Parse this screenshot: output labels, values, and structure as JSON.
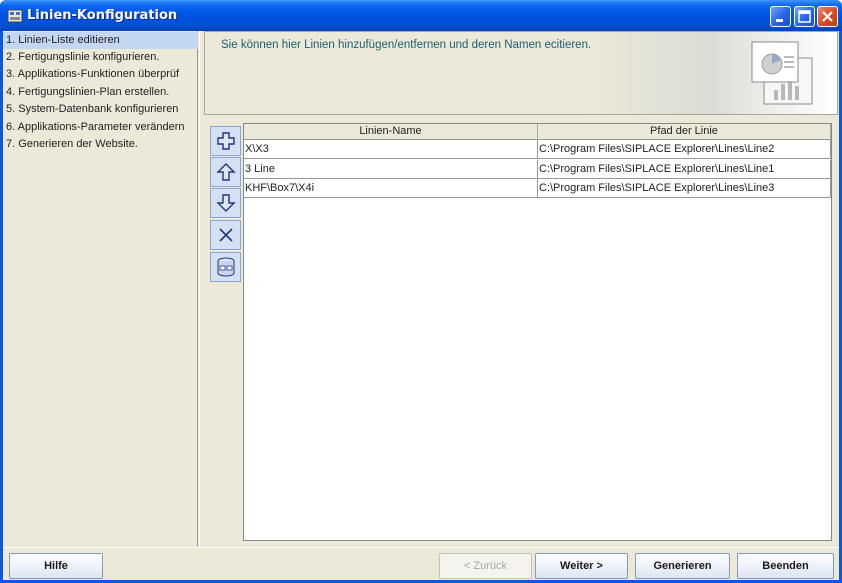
{
  "window": {
    "title": "Linien-Konfiguration"
  },
  "nav": {
    "items": [
      {
        "label": "1. Linien-Liste editieren",
        "active": true
      },
      {
        "label": "2. Fertigungslinie konfigurieren.",
        "active": false
      },
      {
        "label": "3. Applikations-Funktionen überprüf",
        "active": false
      },
      {
        "label": "4. Fertigungslinien-Plan erstellen.",
        "active": false
      },
      {
        "label": "5. System-Datenbank konfigurieren",
        "active": false
      },
      {
        "label": "6. Applikations-Parameter verändern",
        "active": false
      },
      {
        "label": "7. Generieren der Website.",
        "active": false
      }
    ]
  },
  "header": {
    "text": "Sie können hier Linien hinzufügen/entfernen und deren Namen ecitieren."
  },
  "toolbar": {
    "add": "plus-icon",
    "up": "arrow-up-icon",
    "down": "arrow-down-icon",
    "remove": "x-icon",
    "database": "database-icon"
  },
  "table": {
    "columns": [
      "Linien-Name",
      "Pfad der Linie"
    ],
    "rows": [
      [
        "X\\X3",
        "C:\\Program Files\\SIPLACE Explorer\\Lines\\Line2"
      ],
      [
        "3 Line",
        "C:\\Program Files\\SIPLACE Explorer\\Lines\\Line1"
      ],
      [
        "KHF\\Box7\\X4i",
        "C:\\Program Files\\SIPLACE Explorer\\Lines\\Line3"
      ]
    ]
  },
  "buttons": {
    "help": "Hilfe",
    "back": "< Zurück",
    "next": "Weiter >",
    "generate": "Generieren",
    "exit": "Beenden"
  },
  "colors": {
    "titlebar": "#0054e3",
    "accent_text": "#1c6071",
    "selection": "#c4d7f2"
  }
}
